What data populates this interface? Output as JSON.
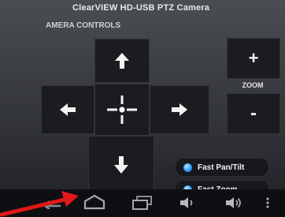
{
  "app": {
    "title": "ClearVIEW HD-USB PTZ Camera",
    "section_label": "AMERA CONTROLS"
  },
  "zoom": {
    "label": "ZOOM",
    "in_symbol": "+",
    "out_symbol": "-"
  },
  "toggles": [
    {
      "label": "Fast Pan/Tilt",
      "state": "on"
    },
    {
      "label": "Fast Zoom",
      "state": "on"
    }
  ],
  "icons": {
    "up": "arrow-up-icon",
    "down": "arrow-down-icon",
    "left": "arrow-left-icon",
    "right": "arrow-right-icon",
    "center": "crosshair-icon"
  },
  "colors": {
    "toggle_on": "#3fa6ff",
    "annotation_arrow": "#e01818",
    "button_bg": "#1b1c20"
  },
  "navbar": {
    "buttons": [
      "back-icon",
      "home-icon",
      "recent-apps-icon",
      "volume-down-icon",
      "volume-up-icon",
      "menu-icon"
    ]
  }
}
